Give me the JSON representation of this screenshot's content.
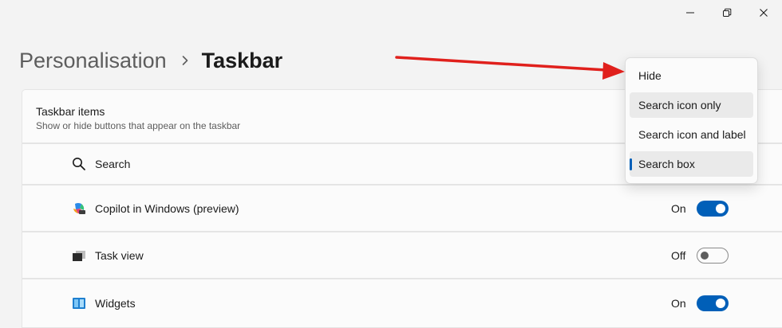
{
  "window_controls": {
    "minimize_icon": "minimize-icon",
    "maximize_icon": "restore-icon",
    "close_icon": "close-icon"
  },
  "breadcrumb": {
    "parent": "Personalisation",
    "current": "Taskbar"
  },
  "section": {
    "title": "Taskbar items",
    "subtitle": "Show or hide buttons that appear on the taskbar"
  },
  "items": [
    {
      "label": "Search",
      "icon": "search-icon"
    },
    {
      "label": "Copilot in Windows (preview)",
      "icon": "copilot-icon",
      "state": "On"
    },
    {
      "label": "Task view",
      "icon": "task-view-icon",
      "state": "Off"
    },
    {
      "label": "Widgets",
      "icon": "widgets-icon",
      "state": "On"
    }
  ],
  "dropdown": {
    "options": [
      "Hide",
      "Search icon only",
      "Search icon and label",
      "Search box"
    ],
    "selected": "Search box",
    "hovered": "Search icon only"
  },
  "colors": {
    "accent": "#005fb8",
    "annotation_arrow": "#e0201c",
    "background": "#f3f3f3",
    "card": "#fbfbfb"
  }
}
